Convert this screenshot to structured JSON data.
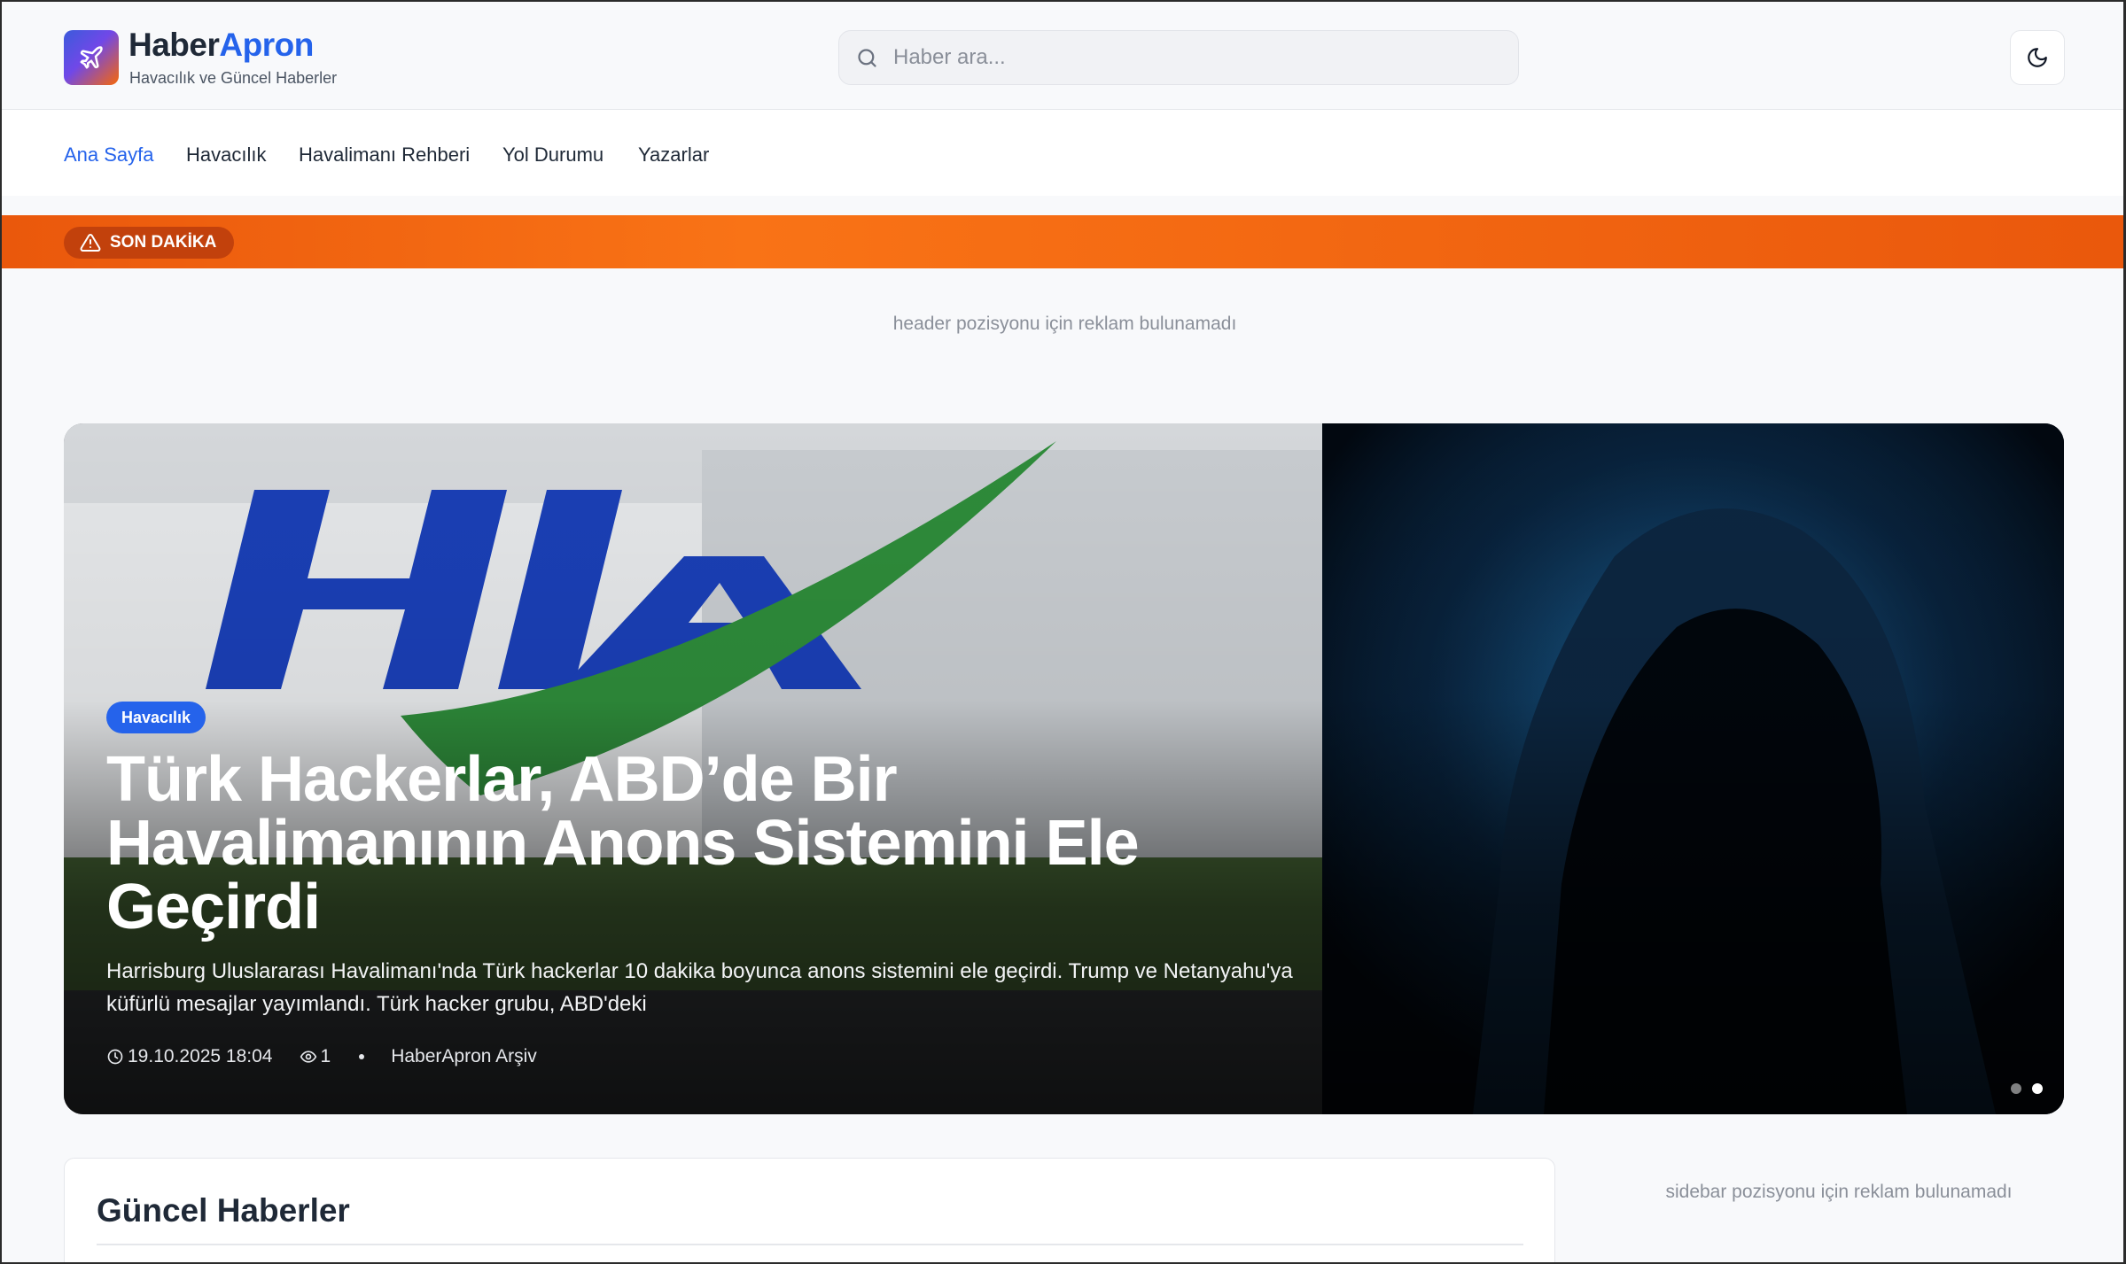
{
  "header": {
    "brand_part1": "Haber",
    "brand_part2": "Apron",
    "tagline": "Havacılık ve Güncel Haberler",
    "search_placeholder": "Haber ara...",
    "logo_icon": "plane-icon",
    "theme_icon": "moon-icon"
  },
  "nav": {
    "items": [
      "Ana Sayfa",
      "Havacılık",
      "Havalimanı Rehberi",
      "Yol Durumu",
      "Yazarlar"
    ],
    "active": "Ana Sayfa"
  },
  "breaking": {
    "label": "SON DAKİKA",
    "icon": "warning-icon"
  },
  "ads": {
    "header": "header pozisyonu için reklam bulunamadı",
    "sidebar": "sidebar pozisyonu için reklam bulunamadı"
  },
  "hero": {
    "category": "Havacılık",
    "title": "Türk Hackerlar, ABD’de Bir Havalimanının Anons Sistemini Ele Geçirdi",
    "excerpt": "Harrisburg Uluslararası Havalimanı'nda Türk hackerlar 10 dakika boyunca anons sistemini ele geçirdi. Trump ve Netanyahu'ya küfürlü mesajlar yayımlandı. Türk hacker grubu, ABD'deki",
    "date": "19.10.2025 18:04",
    "views": "1",
    "author": "HaberApron Arşiv",
    "slide_count": 2,
    "active_slide": 2
  },
  "main": {
    "section_title": "Güncel Haberler"
  },
  "colors": {
    "accent": "#2563eb",
    "breaking": "#ea580c"
  }
}
